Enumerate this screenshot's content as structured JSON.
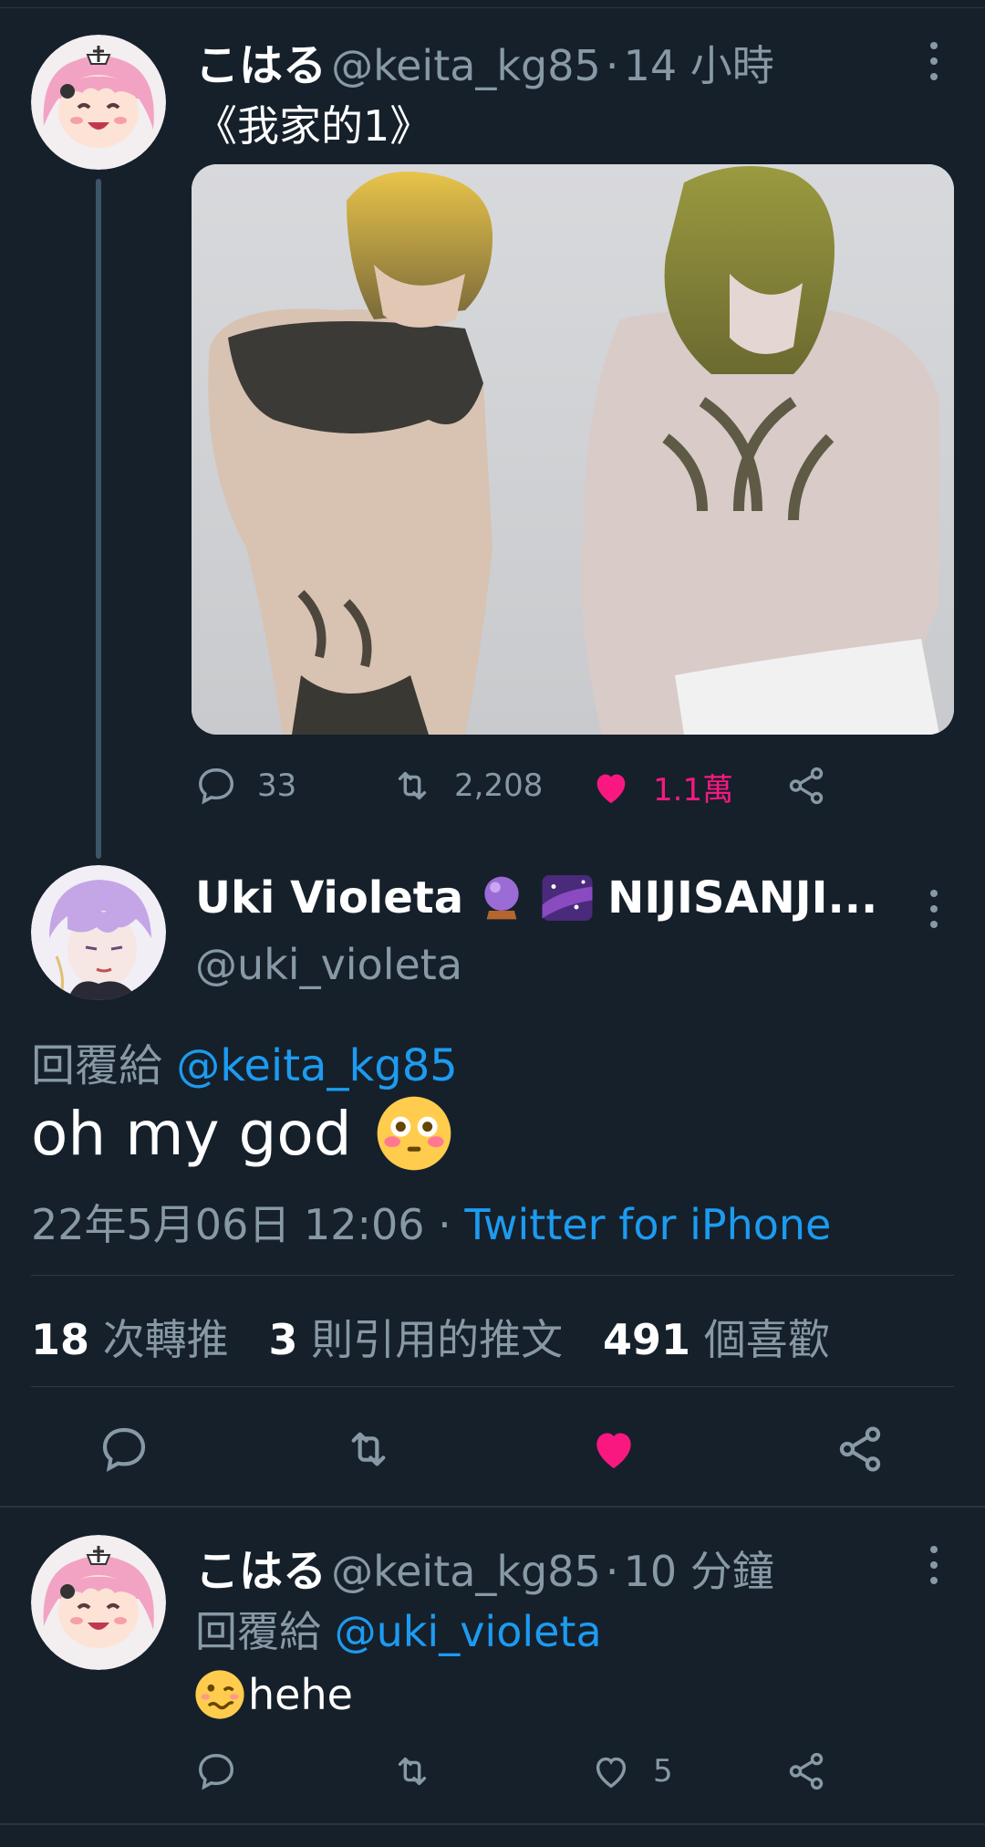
{
  "tweet1": {
    "name": "こはる",
    "handle": "@keita_kg85",
    "separator": "·",
    "time": "14 小時",
    "text": "《我家的1》",
    "image_alt": "Illustration of two shirtless anime characters",
    "replies": "33",
    "retweets": "2,208",
    "likes": "1.1萬",
    "liked": true
  },
  "main_tweet": {
    "name": "Uki Violeta",
    "name_suffix": "NIJISANJI...",
    "handle": "@uki_violeta",
    "reply_prefix": "回覆給",
    "reply_to": "@keita_kg85",
    "text": "oh my god",
    "emoji": "flushed-face",
    "date": "22年5月06日 12:06",
    "separator": "·",
    "source": "Twitter for iPhone",
    "stats": {
      "retweets_num": "18",
      "retweets_label": "次轉推",
      "quotes_num": "3",
      "quotes_label": "則引用的推文",
      "likes_num": "491",
      "likes_label": "個喜歡"
    },
    "liked": true
  },
  "tweet3": {
    "name": "こはる",
    "handle": "@keita_kg85",
    "separator": "·",
    "time": "10 分鐘",
    "reply_prefix": "回覆給",
    "reply_to": "@uki_violeta",
    "text": "hehe",
    "emoji": "woozy-face",
    "likes": "5"
  },
  "colors": {
    "background": "#15202b",
    "accent_blue": "#1d9bf0",
    "like_pink": "#f91880",
    "muted": "#8899a6"
  }
}
